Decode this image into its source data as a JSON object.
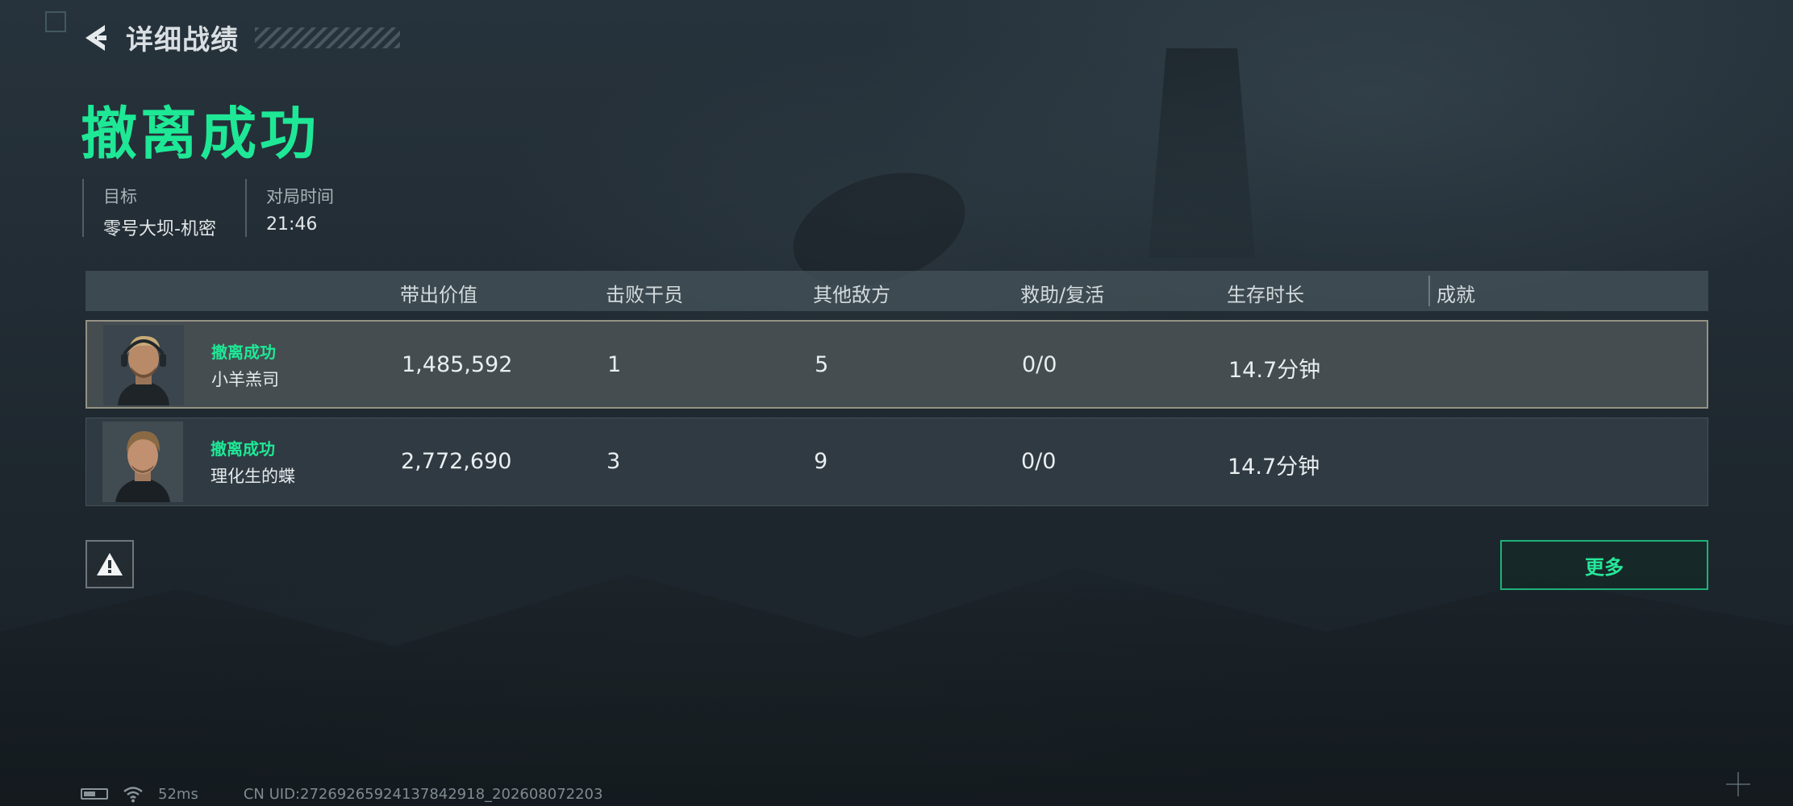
{
  "header": {
    "title": "详细战绩"
  },
  "result_title": "撤离成功",
  "info": {
    "target_label": "目标",
    "target_value": "零号大坝-机密",
    "time_label": "对局时间",
    "time_value": "21:46"
  },
  "table": {
    "columns": [
      "带出价值",
      "击败干员",
      "其他敌方",
      "救助/复活",
      "生存时长",
      "成就"
    ],
    "rows": [
      {
        "status": "撤离成功",
        "name": "小羊羔司",
        "value": "1,485,592",
        "kills": "1",
        "other_enemies": "5",
        "assist_revive": "0/0",
        "survival_time": "14.7分钟",
        "achievement": "",
        "selected": true
      },
      {
        "status": "撤离成功",
        "name": "理化生的蝶",
        "value": "2,772,690",
        "kills": "3",
        "other_enemies": "9",
        "assist_revive": "0/0",
        "survival_time": "14.7分钟",
        "achievement": "",
        "selected": false
      }
    ]
  },
  "actions": {
    "more_label": "更多",
    "report_icon": "warning-icon"
  },
  "statusbar": {
    "ping": "52ms",
    "uid": "CN UID:272692659241378429­18_202608072203"
  },
  "colors": {
    "accent_green": "#1ee896",
    "button_border": "#1fb07a"
  }
}
